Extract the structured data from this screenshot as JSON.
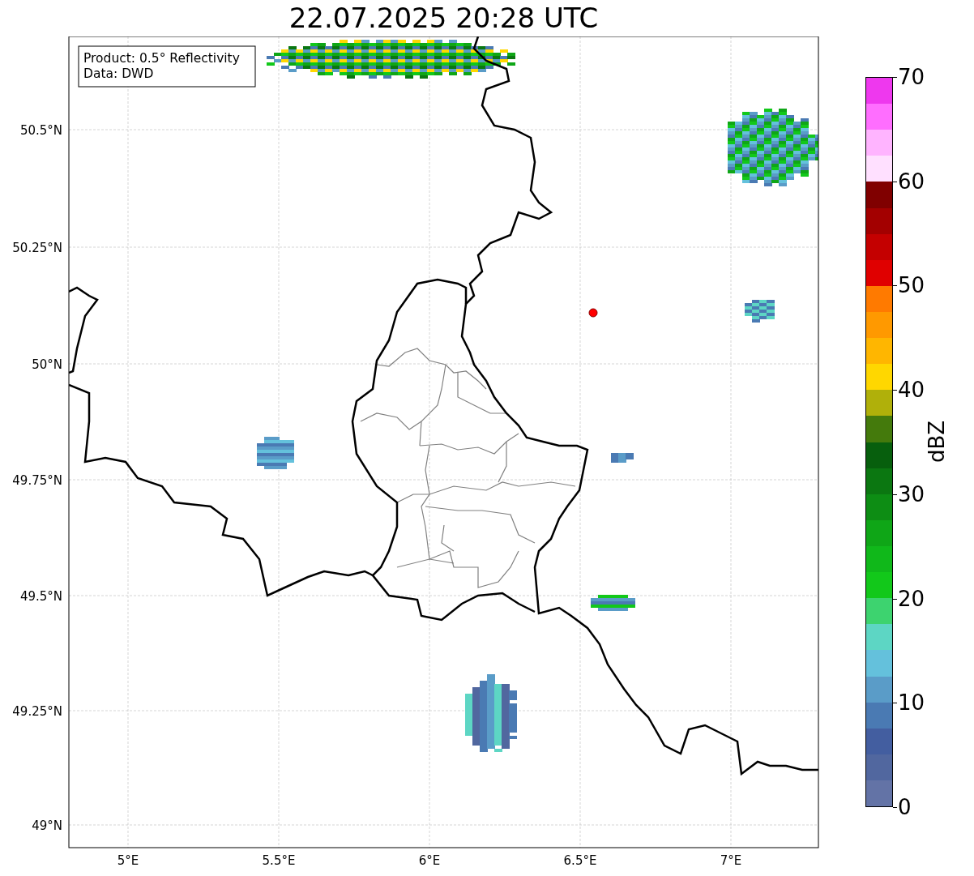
{
  "title": "22.07.2025 20:28 UTC",
  "info_box": {
    "lines": [
      "Product: 0.5° Reflectivity",
      "Data: DWD"
    ]
  },
  "map": {
    "lat_ticks": [
      "50.5°N",
      "50.25°N",
      "50°N",
      "49.75°N",
      "49.5°N",
      "49.25°N",
      "49°N"
    ],
    "lon_ticks": [
      "5°E",
      "5.5°E",
      "6°E",
      "6.5°E",
      "7°E"
    ]
  },
  "colorbar": {
    "label": "dBZ",
    "ticks": [
      "70",
      "60",
      "50",
      "40",
      "30",
      "20",
      "10",
      "0"
    ],
    "bins": [
      {
        "color": "#ee38ee"
      },
      {
        "color": "#ff6eff"
      },
      {
        "color": "#ffb4ff"
      },
      {
        "color": "#ffe0ff"
      },
      {
        "color": "#800000"
      },
      {
        "color": "#a30000"
      },
      {
        "color": "#c40000"
      },
      {
        "color": "#e00000"
      },
      {
        "color": "#ff7a00"
      },
      {
        "color": "#ff9900"
      },
      {
        "color": "#ffb600"
      },
      {
        "color": "#ffd700"
      },
      {
        "color": "#b0b00a"
      },
      {
        "color": "#447a0c"
      },
      {
        "color": "#075f0d"
      },
      {
        "color": "#0b7711"
      },
      {
        "color": "#0d8d14"
      },
      {
        "color": "#0fa617"
      },
      {
        "color": "#10b81a"
      },
      {
        "color": "#12c81a"
      },
      {
        "color": "#3dd36f"
      },
      {
        "color": "#5dd6c4"
      },
      {
        "color": "#64c1dc"
      },
      {
        "color": "#5a9cc8"
      },
      {
        "color": "#4a7ab3"
      },
      {
        "color": "#435ea0"
      },
      {
        "color": "#51679f"
      },
      {
        "color": "#6373a6"
      }
    ]
  }
}
